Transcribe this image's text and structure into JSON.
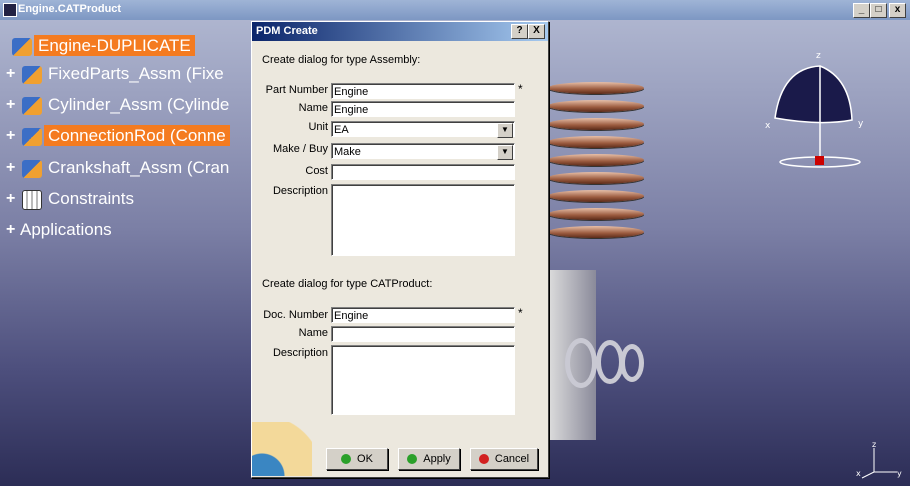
{
  "window": {
    "title": "Engine.CATProduct",
    "buttons": [
      "_",
      "□",
      "x"
    ]
  },
  "tree": {
    "root": "Engine-DUPLICATE",
    "items": [
      {
        "label": "FixedParts_Assm (Fixe",
        "highlight": false
      },
      {
        "label": "Cylinder_Assm (Cylinde",
        "highlight": false
      },
      {
        "label": "ConnectionRod (Conne",
        "highlight": true
      },
      {
        "label": "Crankshaft_Assm (Cran",
        "highlight": false
      },
      {
        "label": "Constraints",
        "highlight": false
      },
      {
        "label": "Applications",
        "highlight": false
      }
    ]
  },
  "dialog": {
    "title": "PDM Create",
    "help_button": "?",
    "close_button": "X",
    "assembly_header": "Create dialog for type Assembly:",
    "fields": {
      "part_number": {
        "label": "Part Number",
        "value": "Engine"
      },
      "name": {
        "label": "Name",
        "value": "Engine"
      },
      "unit": {
        "label": "Unit",
        "value": "EA"
      },
      "make_buy": {
        "label": "Make / Buy",
        "value": "Make"
      },
      "cost": {
        "label": "Cost",
        "value": ""
      },
      "description": {
        "label": "Description",
        "value": ""
      }
    },
    "product_header": "Create dialog for type CATProduct:",
    "product_fields": {
      "doc_number": {
        "label": "Doc. Number",
        "value": "Engine"
      },
      "name": {
        "label": "Name",
        "value": ""
      },
      "description": {
        "label": "Description",
        "value": ""
      }
    },
    "required_mark": "*",
    "buttons": {
      "ok": "OK",
      "apply": "Apply",
      "cancel": "Cancel"
    }
  },
  "compass": {
    "z": "z",
    "x": "x",
    "y": "y"
  },
  "axes": {
    "z": "z",
    "x": "x",
    "y": "y"
  },
  "colors": {
    "highlight": "#f47b20",
    "ok_led": "#2aa02a",
    "apply_led": "#2aa02a",
    "cancel_led": "#d22020"
  }
}
